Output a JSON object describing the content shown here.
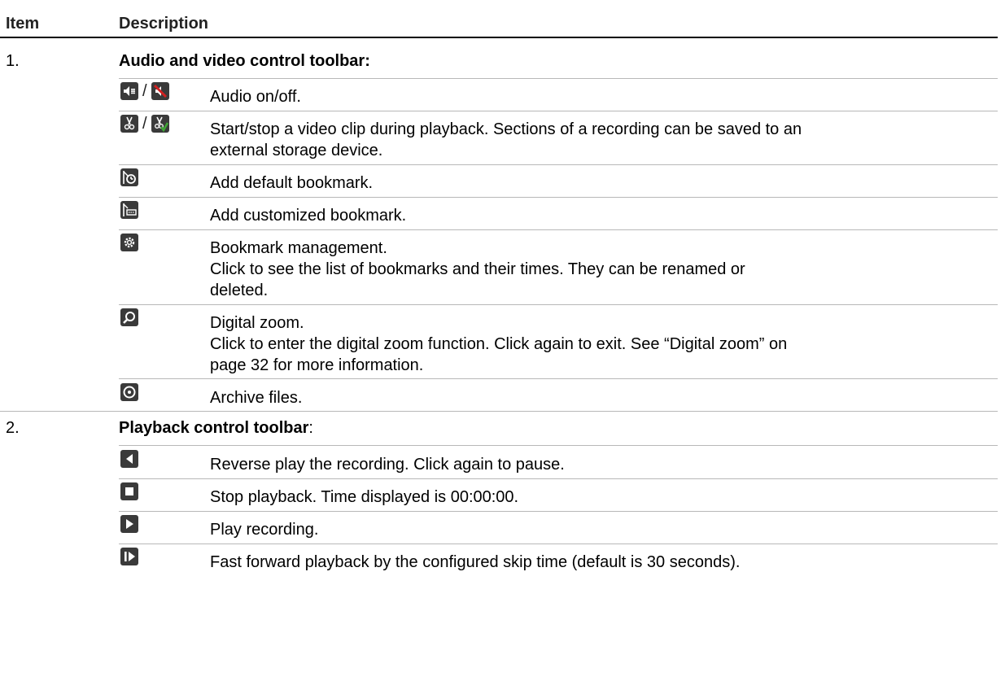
{
  "header": {
    "item": "Item",
    "description": "Description"
  },
  "sections": [
    {
      "number": "1.",
      "title": "Audio and video control toolbar:",
      "rows": [
        {
          "icons": [
            "audio-on-icon",
            "audio-off-icon"
          ],
          "lines": [
            "Audio on/off."
          ]
        },
        {
          "icons": [
            "clip-start-icon",
            "clip-stop-icon"
          ],
          "lines": [
            "Start/stop a video clip during playback. Sections of a recording can be saved to an",
            "external storage device."
          ]
        },
        {
          "icons": [
            "default-bookmark-icon"
          ],
          "lines": [
            "Add default bookmark."
          ]
        },
        {
          "icons": [
            "custom-bookmark-icon"
          ],
          "lines": [
            "Add customized bookmark."
          ]
        },
        {
          "icons": [
            "bookmark-management-icon"
          ],
          "lines": [
            "Bookmark management.",
            "Click to see the list of bookmarks and their times. They can be renamed or",
            "deleted."
          ]
        },
        {
          "icons": [
            "digital-zoom-icon"
          ],
          "lines": [
            "Digital zoom.",
            "Click to enter the digital zoom function. Click again to exit. See “Digital zoom” on",
            "page 32 for more information."
          ]
        },
        {
          "icons": [
            "archive-icon"
          ],
          "lines": [
            "Archive files."
          ]
        }
      ]
    },
    {
      "number": "2.",
      "title": "Playback control toolbar",
      "title_suffix": ":",
      "rows": [
        {
          "icons": [
            "reverse-play-icon"
          ],
          "lines": [
            "Reverse play the recording. Click again to pause."
          ]
        },
        {
          "icons": [
            "stop-icon"
          ],
          "lines": [
            "Stop playback. Time displayed is 00:00:00."
          ]
        },
        {
          "icons": [
            "play-icon"
          ],
          "lines": [
            "Play recording."
          ]
        },
        {
          "icons": [
            "fast-forward-icon"
          ],
          "lines": [
            "Fast forward playback by the configured skip time (default is 30 seconds)."
          ]
        }
      ]
    }
  ],
  "separator": "/",
  "colors": {
    "icon_bg": "#3a3a3a",
    "icon_red": "#d22020",
    "icon_green": "#3fa535",
    "rule": "#b8b8b8"
  }
}
